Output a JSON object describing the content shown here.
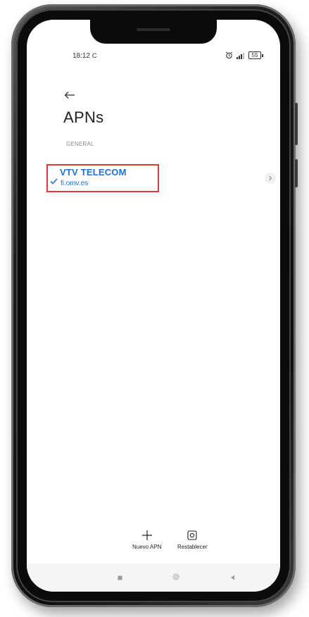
{
  "status_bar": {
    "time": "18:12",
    "battery": "55"
  },
  "header": {
    "title": "APNs"
  },
  "section": {
    "label": "GENERAL"
  },
  "apn_list": [
    {
      "name": "VTV TELECOM",
      "apn": "fi.omv.es",
      "selected": true
    }
  ],
  "actions": {
    "new_apn_label": "Nuevo APN",
    "reset_label": "Restablecer"
  },
  "colors": {
    "accent": "#1e6fd9",
    "highlight_box": "#e23a3a",
    "title_text": "#1f1f1f",
    "section_text": "#8a8a8a"
  },
  "icons": {
    "back": "arrow-left",
    "check": "checkmark",
    "chevron": "chevron-right",
    "new": "plus",
    "reset": "square-reset",
    "nav_recents": "square",
    "nav_home": "circle",
    "nav_back": "triangle-left"
  }
}
